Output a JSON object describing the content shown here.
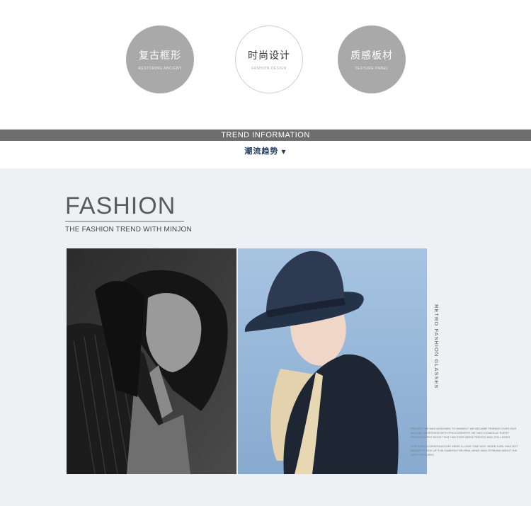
{
  "circles": [
    {
      "cn": "复古框形",
      "en": "RESTORING ANCIENT",
      "style": "gray"
    },
    {
      "cn": "时尚设计",
      "en": "FASHION DESIGN",
      "style": "white"
    },
    {
      "cn": "质感板材",
      "en": "TEXTURE PANEL",
      "style": "gray"
    }
  ],
  "section": {
    "bar_label": "TREND INFORMATION",
    "subhead": "潮流趋势",
    "arrow": "▼"
  },
  "feature": {
    "title": "FASHION",
    "subtitle": "THE FASHION TREND WITH MINJON",
    "vertical_text": "RETRO FASHION GLASSES",
    "para1": "PROJECT HE WAS ASSIGNED TO HIMSELF. WE BECAME FRIENDS OVER OUR MUTUAL OBSESSION WITH PHOTOGRAPHY. HE HAS LOOKED AT EVERY PHOTOGRAPHY BOOK THAT HAS EVER BEEN PRINTED AND STILL DOES.",
    "para2": "OUR FIRST CONVERSATIONS WERE A LONG TIME AGO. WHEN KARL WAS NOT ABOUT TO PICK UP THE CAMERA FOR REAL WHAT WAS STRIKING ABOUT HIS FIRST PICTURES"
  },
  "colors": {
    "circle_gray": "#a9a9a9",
    "bar": "#6e6e6e",
    "panel_bg": "#edf1f4",
    "subhead": "#1f3b5c"
  }
}
